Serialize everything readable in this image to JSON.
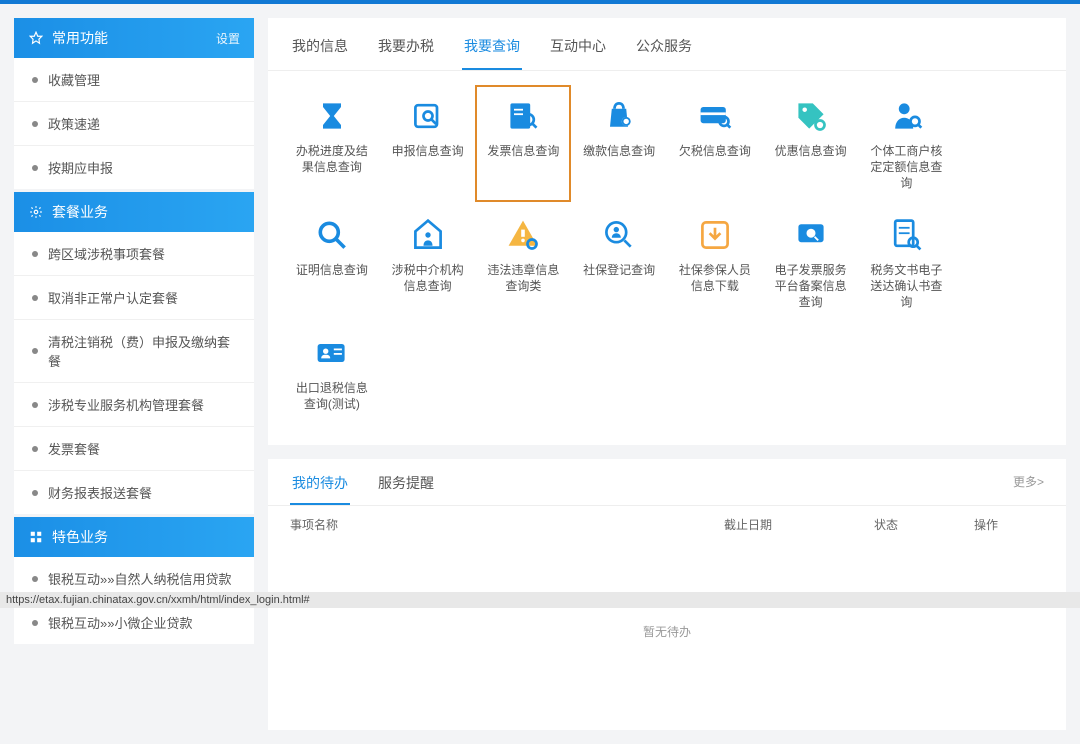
{
  "sidebar": {
    "sections": [
      {
        "title": "常用功能",
        "icon": "star",
        "settings": "设置",
        "items": [
          "收藏管理",
          "政策速递",
          "按期应申报"
        ]
      },
      {
        "title": "套餐业务",
        "icon": "gear",
        "items": [
          "跨区域涉税事项套餐",
          "取消非正常户认定套餐",
          "清税注销税（费）申报及缴纳套餐",
          "涉税专业服务机构管理套餐",
          "发票套餐",
          "财务报表报送套餐"
        ]
      },
      {
        "title": "特色业务",
        "icon": "grid",
        "items": [
          "银税互动»»自然人纳税信用贷款",
          "银税互动»»小微企业贷款"
        ]
      }
    ]
  },
  "tabs": [
    {
      "label": "我的信息",
      "active": false
    },
    {
      "label": "我要办税",
      "active": false
    },
    {
      "label": "我要查询",
      "active": true
    },
    {
      "label": "互动中心",
      "active": false
    },
    {
      "label": "公众服务",
      "active": false
    }
  ],
  "grid": [
    {
      "label": "办税进度及结果信息查询",
      "icon": "hourglass",
      "color": "#1a8be0"
    },
    {
      "label": "申报信息查询",
      "icon": "calendar-search",
      "color": "#1a8be0"
    },
    {
      "label": "发票信息查询",
      "icon": "invoice-search",
      "color": "#1a8be0",
      "highlight": true
    },
    {
      "label": "缴款信息查询",
      "icon": "bag-search",
      "color": "#1a8be0"
    },
    {
      "label": "欠税信息查询",
      "icon": "card-search",
      "color": "#1a8be0"
    },
    {
      "label": "优惠信息查询",
      "icon": "discount-search",
      "color": "#35c3c1"
    },
    {
      "label": "个体工商户核定定额信息查询",
      "icon": "person-search",
      "color": "#1a8be0"
    },
    null,
    {
      "label": "证明信息查询",
      "icon": "magnify",
      "color": "#1a8be0"
    },
    {
      "label": "涉税中介机构信息查询",
      "icon": "house-person",
      "color": "#1a8be0"
    },
    {
      "label": "违法违章信息查询类",
      "icon": "warn-search",
      "color": "#f5b642"
    },
    {
      "label": "社保登记查询",
      "icon": "social-search",
      "color": "#1a8be0"
    },
    {
      "label": "社保参保人员信息下载",
      "icon": "download",
      "color": "#f5a742"
    },
    {
      "label": "电子发票服务平台备案信息查询",
      "icon": "platform",
      "color": "#1a8be0"
    },
    {
      "label": "税务文书电子送达确认书查询",
      "icon": "doc-search",
      "color": "#1a8be0"
    },
    null,
    {
      "label": "出口退税信息查询(测试)",
      "icon": "id-card",
      "color": "#1a8be0"
    }
  ],
  "todo": {
    "tabs": [
      {
        "label": "我的待办",
        "active": true
      },
      {
        "label": "服务提醒",
        "active": false
      }
    ],
    "more": "更多>",
    "header": {
      "name": "事项名称",
      "deadline": "截止日期",
      "status": "状态",
      "action": "操作"
    },
    "empty": "暂无待办"
  },
  "status_url": "https://etax.fujian.chinatax.gov.cn/xxmh/html/index_login.html#"
}
